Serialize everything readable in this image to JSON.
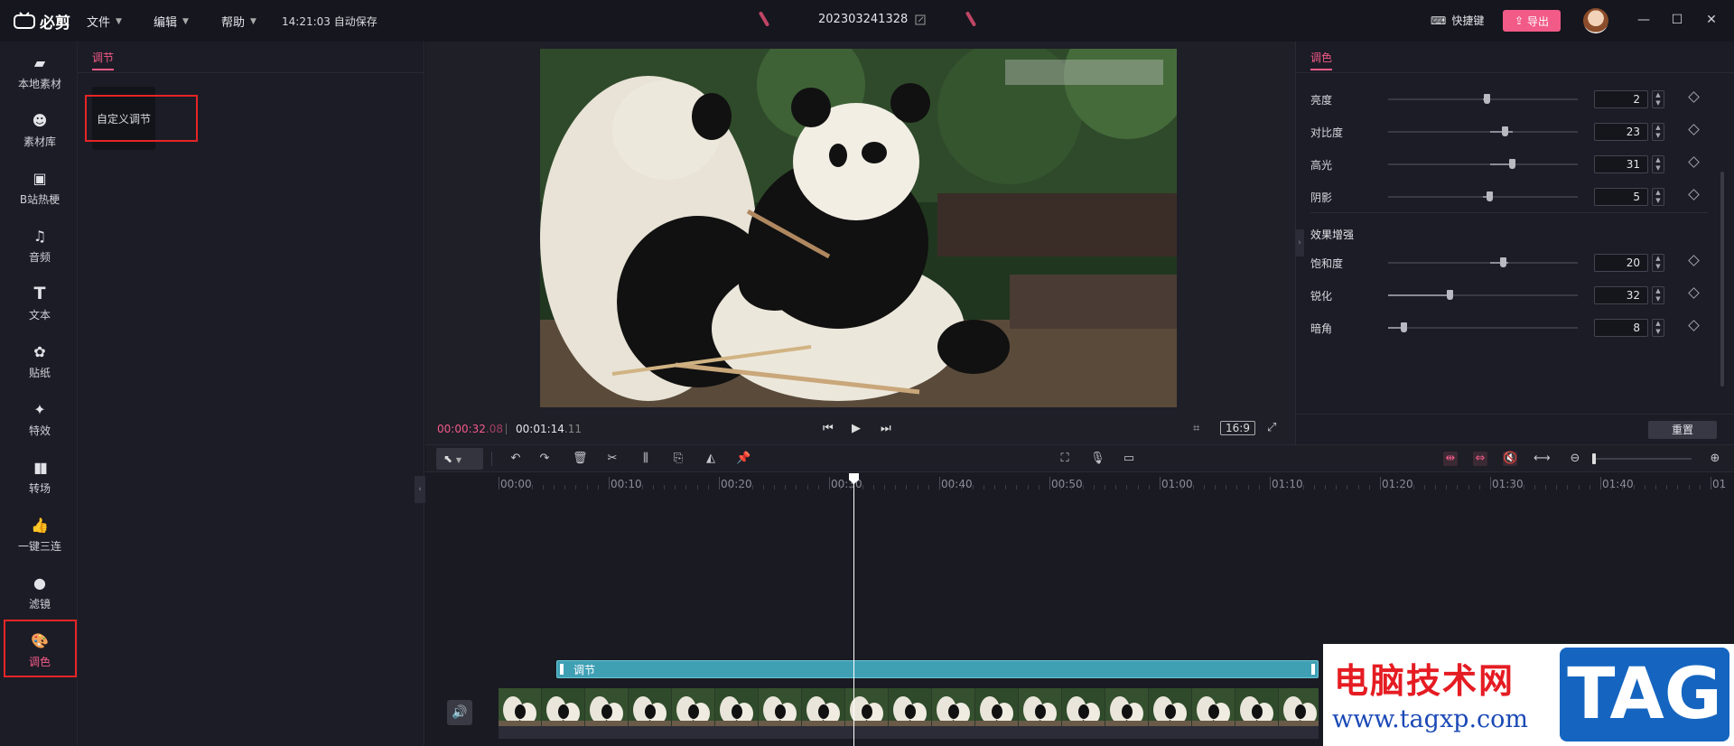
{
  "app": {
    "logo_text": "必剪",
    "menus": [
      {
        "label": "文件"
      },
      {
        "label": "编辑"
      },
      {
        "label": "帮助"
      }
    ],
    "autosave_text": "14:21:03 自动保存",
    "project_name": "202303241328",
    "shortcut_label": "快捷键",
    "export_label": "导出"
  },
  "nav": {
    "items": [
      {
        "label": "本地素材",
        "icon": "folder-icon"
      },
      {
        "label": "素材库",
        "icon": "face-icon"
      },
      {
        "label": "B站热梗",
        "icon": "tv-icon"
      },
      {
        "label": "音频",
        "icon": "music-icon"
      },
      {
        "label": "文本",
        "icon": "text-icon"
      },
      {
        "label": "贴纸",
        "icon": "sticker-icon"
      },
      {
        "label": "特效",
        "icon": "magic-icon"
      },
      {
        "label": "转场",
        "icon": "transition-icon"
      },
      {
        "label": "一键三连",
        "icon": "thumbs-up-icon"
      },
      {
        "label": "滤镜",
        "icon": "filter-icon"
      },
      {
        "label": "调色",
        "icon": "palette-icon"
      }
    ]
  },
  "adjust_panel": {
    "tab": "调节",
    "card_label": "自定义调节"
  },
  "preview": {
    "current_time_main": "00:00:32",
    "current_time_frames": ".08",
    "total_time_main": "00:01:14",
    "total_time_frames": ".11",
    "aspect_ratio": "16:9"
  },
  "color_panel": {
    "tab": "调色",
    "basic_rows": [
      {
        "label": "亮度",
        "value": "2"
      },
      {
        "label": "对比度",
        "value": "23"
      },
      {
        "label": "高光",
        "value": "31"
      },
      {
        "label": "阴影",
        "value": "5"
      }
    ],
    "enhance_title": "效果增强",
    "enhance_rows": [
      {
        "label": "饱和度",
        "value": "20"
      },
      {
        "label": "锐化",
        "value": "32"
      },
      {
        "label": "暗角",
        "value": "8"
      }
    ],
    "reset_label": "重置"
  },
  "timeline": {
    "ruler": [
      "00:00",
      "00:10",
      "00:20",
      "00:30",
      "00:40",
      "00:50",
      "01:00",
      "01:10",
      "01:20",
      "01:30",
      "01:40",
      "01"
    ],
    "adjust_clip_label": "调节"
  },
  "watermark": {
    "cn": "电脑技术网",
    "url": "www.tagxp.com",
    "tag": "TAG"
  },
  "colors": {
    "accent": "#f25a87",
    "adjust_clip": "#3fa0b4",
    "highlight_box": "#e52525"
  }
}
